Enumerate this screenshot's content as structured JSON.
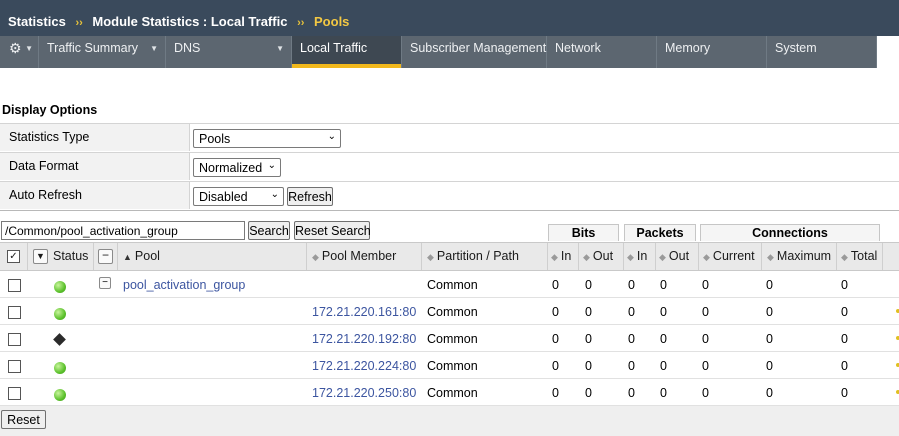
{
  "breadcrumb": {
    "part1": "Statistics",
    "sep": "››",
    "part2": "Module Statistics : Local Traffic",
    "current": "Pools"
  },
  "nav": {
    "gear": "⚙",
    "tabs": [
      "Traffic Summary",
      "DNS",
      "Local Traffic",
      "Subscriber Management",
      "Network",
      "Memory",
      "System"
    ],
    "active": "Local Traffic"
  },
  "display_options": {
    "title": "Display Options",
    "statistics_type": {
      "label": "Statistics Type",
      "value": "Pools"
    },
    "data_format": {
      "label": "Data Format",
      "value": "Normalized"
    },
    "auto_refresh": {
      "label": "Auto Refresh",
      "value": "Disabled",
      "button": "Refresh"
    }
  },
  "search": {
    "value": "/Common/pool_activation_group",
    "search_button": "Search",
    "reset_button": "Reset Search"
  },
  "groups": {
    "bits": "Bits",
    "packets": "Packets",
    "connections": "Connections"
  },
  "columns": {
    "status": "Status",
    "pool": "Pool",
    "pool_member": "Pool Member",
    "partition": "Partition / Path",
    "bits_in": "In",
    "bits_out": "Out",
    "packets_in": "In",
    "packets_out": "Out",
    "current": "Current",
    "maximum": "Maximum",
    "total": "Total"
  },
  "rows": [
    {
      "status": "available",
      "pool": "pool_activation_group",
      "member": "",
      "partition": "Common",
      "bits_in": "0",
      "bits_out": "0",
      "pkts_in": "0",
      "pkts_out": "0",
      "current": "0",
      "maximum": "0",
      "total": "0"
    },
    {
      "status": "available",
      "pool": "",
      "member": "172.21.220.161:80",
      "partition": "Common",
      "bits_in": "0",
      "bits_out": "0",
      "pkts_in": "0",
      "pkts_out": "0",
      "current": "0",
      "maximum": "0",
      "total": "0"
    },
    {
      "status": "unknown",
      "pool": "",
      "member": "172.21.220.192:80",
      "partition": "Common",
      "bits_in": "0",
      "bits_out": "0",
      "pkts_in": "0",
      "pkts_out": "0",
      "current": "0",
      "maximum": "0",
      "total": "0"
    },
    {
      "status": "available",
      "pool": "",
      "member": "172.21.220.224:80",
      "partition": "Common",
      "bits_in": "0",
      "bits_out": "0",
      "pkts_in": "0",
      "pkts_out": "0",
      "current": "0",
      "maximum": "0",
      "total": "0"
    },
    {
      "status": "available",
      "pool": "",
      "member": "172.21.220.250:80",
      "partition": "Common",
      "bits_in": "0",
      "bits_out": "0",
      "pkts_in": "0",
      "pkts_out": "0",
      "current": "0",
      "maximum": "0",
      "total": "0"
    }
  ],
  "footer": {
    "reset": "Reset"
  },
  "colors": {
    "header_bg": "#3a4a5c",
    "nav_bg": "#5c6670",
    "active_accent": "#f1b81c",
    "link": "#3c55a0",
    "status_green": "#5cc12c"
  }
}
